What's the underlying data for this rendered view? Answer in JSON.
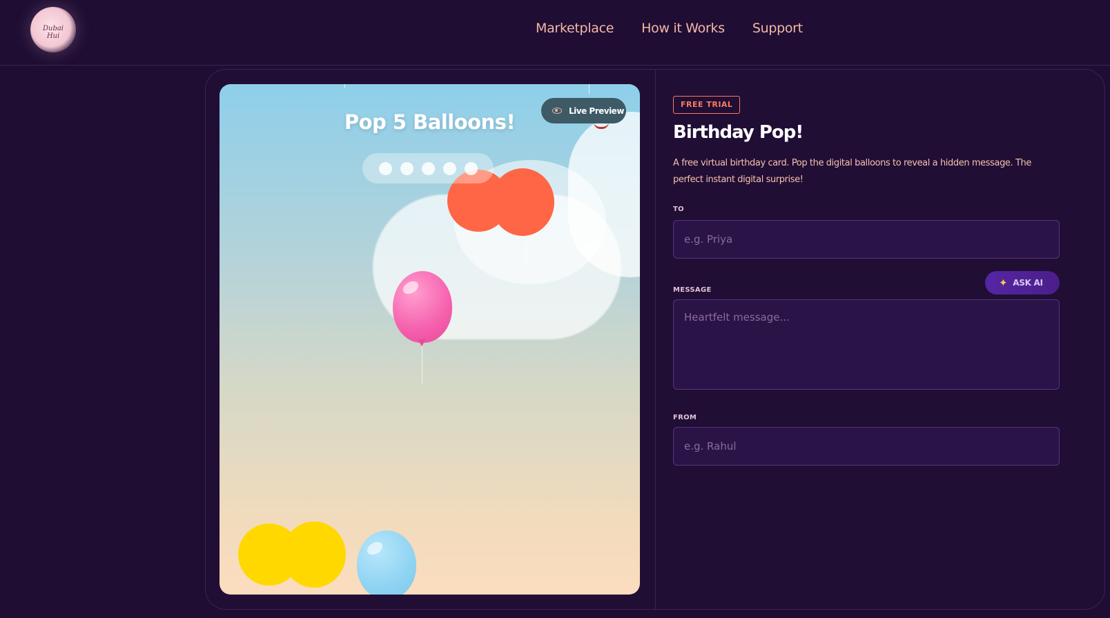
{
  "header": {
    "logo_text": "Dubai Hui",
    "nav": [
      "Marketplace",
      "How it Works",
      "Support"
    ]
  },
  "preview": {
    "title": "Pop 5 Balloons!",
    "live_label": "Live Preview",
    "balloons_remaining": 5
  },
  "form": {
    "badge": "FREE TRIAL",
    "title": "Birthday Pop!",
    "description": "A free virtual birthday card. Pop the digital balloons to reveal a hidden message. The perfect instant digital surprise!",
    "to_label": "TO",
    "to_placeholder": "e.g. Priya",
    "message_label": "MESSAGE",
    "message_placeholder": "Heartfelt message...",
    "ask_ai_label": "ASK AI",
    "from_label": "FROM",
    "from_placeholder": "e.g. Rahul"
  },
  "colors": {
    "background": "#1f0d33",
    "accent": "#ff7b5f",
    "nav_text": "#f4b8a8",
    "field_bg": "#2a1447",
    "red_balloon": "#ff6645",
    "yellow_balloon": "#ffd800",
    "pink_balloon": "#f55fac",
    "blue_balloon": "#8ed3f2"
  }
}
